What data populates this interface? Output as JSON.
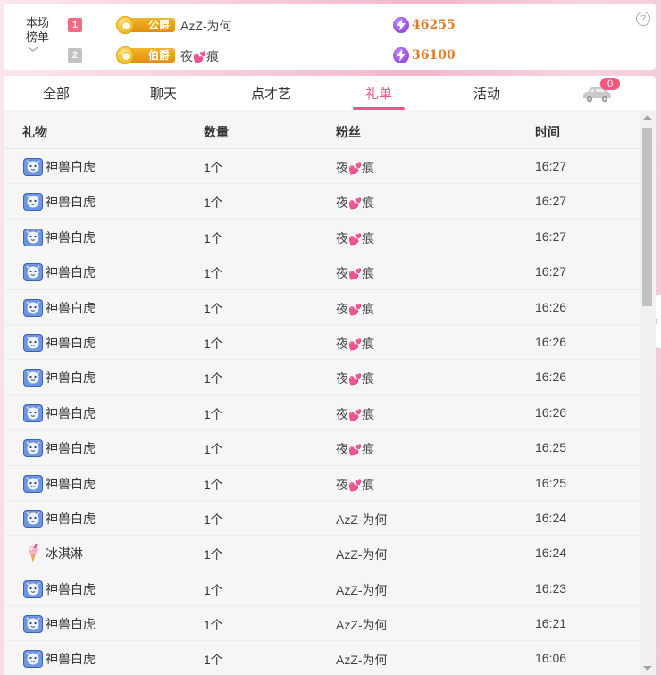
{
  "rank": {
    "title_line1": "本场",
    "title_line2": "榜单",
    "help": "?",
    "entries": [
      {
        "pos": "1",
        "badge": "公爵",
        "name": "AzZ-为何",
        "score": "46255"
      },
      {
        "pos": "2",
        "badge": "伯爵",
        "name_prefix": "夜",
        "name_suffix": "痕",
        "score": "36100"
      }
    ]
  },
  "tabs": [
    {
      "label": "全部"
    },
    {
      "label": "聊天"
    },
    {
      "label": "点才艺"
    },
    {
      "label": "礼单",
      "active": true
    },
    {
      "label": "活动"
    }
  ],
  "car_badge": "0",
  "table": {
    "headers": {
      "gift": "礼物",
      "qty": "数量",
      "fan": "粉丝",
      "time": "时间"
    },
    "rows": [
      {
        "gift": "神兽白虎",
        "icon": "tiger-icon",
        "qty": "1个",
        "fan": "夜💕痕",
        "time": "16:27"
      },
      {
        "gift": "神兽白虎",
        "icon": "tiger-icon",
        "qty": "1个",
        "fan": "夜💕痕",
        "time": "16:27"
      },
      {
        "gift": "神兽白虎",
        "icon": "tiger-icon",
        "qty": "1个",
        "fan": "夜💕痕",
        "time": "16:27"
      },
      {
        "gift": "神兽白虎",
        "icon": "tiger-icon",
        "qty": "1个",
        "fan": "夜💕痕",
        "time": "16:27"
      },
      {
        "gift": "神兽白虎",
        "icon": "tiger-icon",
        "qty": "1个",
        "fan": "夜💕痕",
        "time": "16:26"
      },
      {
        "gift": "神兽白虎",
        "icon": "tiger-icon",
        "qty": "1个",
        "fan": "夜💕痕",
        "time": "16:26"
      },
      {
        "gift": "神兽白虎",
        "icon": "tiger-icon",
        "qty": "1个",
        "fan": "夜💕痕",
        "time": "16:26"
      },
      {
        "gift": "神兽白虎",
        "icon": "tiger-icon",
        "qty": "1个",
        "fan": "夜💕痕",
        "time": "16:26"
      },
      {
        "gift": "神兽白虎",
        "icon": "tiger-icon",
        "qty": "1个",
        "fan": "夜💕痕",
        "time": "16:25"
      },
      {
        "gift": "神兽白虎",
        "icon": "tiger-icon",
        "qty": "1个",
        "fan": "夜💕痕",
        "time": "16:25"
      },
      {
        "gift": "神兽白虎",
        "icon": "tiger-icon",
        "qty": "1个",
        "fan": "AzZ-为何",
        "time": "16:24"
      },
      {
        "gift": "冰淇淋",
        "icon": "ice-cream-icon",
        "qty": "1个",
        "fan": "AzZ-为何",
        "time": "16:24"
      },
      {
        "gift": "神兽白虎",
        "icon": "tiger-icon",
        "qty": "1个",
        "fan": "AzZ-为何",
        "time": "16:23"
      },
      {
        "gift": "神兽白虎",
        "icon": "tiger-icon",
        "qty": "1个",
        "fan": "AzZ-为何",
        "time": "16:21"
      },
      {
        "gift": "神兽白虎",
        "icon": "tiger-icon",
        "qty": "1个",
        "fan": "AzZ-为何",
        "time": "16:06"
      }
    ]
  },
  "colors": {
    "accent": "#f0568a",
    "score": "#e87a23",
    "rank1": "#f26b7f",
    "rank2": "#c2c2c2"
  }
}
